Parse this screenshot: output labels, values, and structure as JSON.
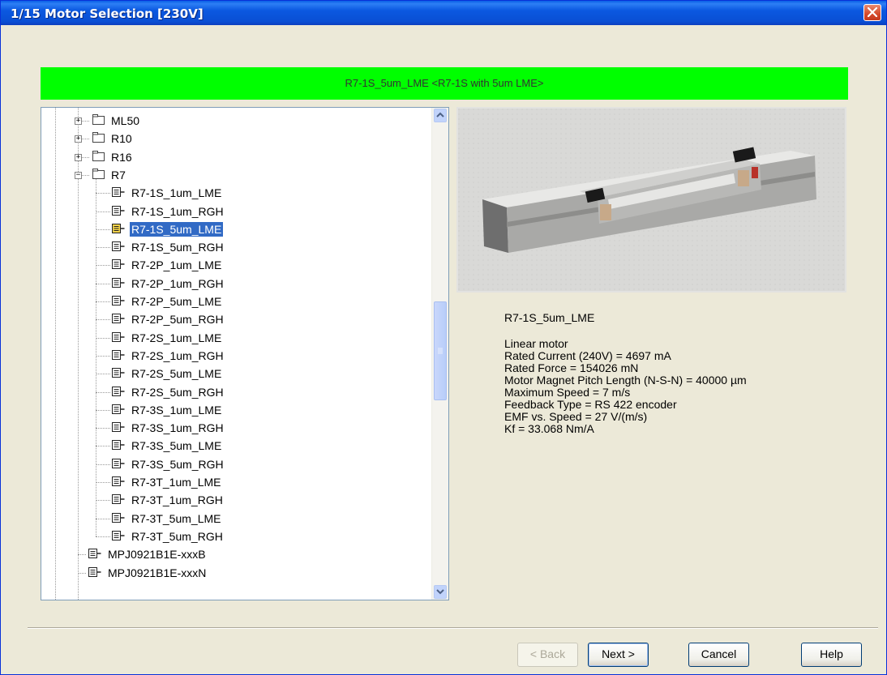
{
  "window": {
    "title": "1/15 Motor Selection [230V]"
  },
  "banner": {
    "text": "R7-1S_5um_LME  <R7-1S with 5um LME>",
    "color": "#00ff00"
  },
  "tree": {
    "folders": [
      "ML50",
      "R10",
      "R16",
      "R7"
    ],
    "r7_items": [
      "R7-1S_1um_LME",
      "R7-1S_1um_RGH",
      "R7-1S_5um_LME",
      "R7-1S_5um_RGH",
      "R7-2P_1um_LME",
      "R7-2P_1um_RGH",
      "R7-2P_5um_LME",
      "R7-2P_5um_RGH",
      "R7-2S_1um_LME",
      "R7-2S_1um_RGH",
      "R7-2S_5um_LME",
      "R7-2S_5um_RGH",
      "R7-3S_1um_LME",
      "R7-3S_1um_RGH",
      "R7-3S_5um_LME",
      "R7-3S_5um_RGH",
      "R7-3T_1um_LME",
      "R7-3T_1um_RGH",
      "R7-3T_5um_LME",
      "R7-3T_5um_RGH"
    ],
    "selected": "R7-1S_5um_LME",
    "bottom_items": [
      "MPJ0921B1E-xxxB",
      "MPJ0921B1E-xxxN"
    ]
  },
  "details": {
    "name": "R7-1S_5um_LME",
    "lines": [
      "Linear motor",
      "Rated Current (240V)  =  4697 mA",
      "Rated Force  =  154026 mN",
      "Motor Magnet Pitch Length (N-S-N)  =  40000 µm",
      "Maximum Speed  =  7 m/s",
      "Feedback Type = RS 422 encoder",
      "EMF vs. Speed  =  27 V/(m/s)",
      "Kf = 33.068 Nm/A"
    ]
  },
  "buttons": {
    "back": "< Back",
    "next": "Next >",
    "cancel": "Cancel",
    "help": "Help"
  },
  "icons": {
    "close": "close-icon",
    "folder": "folder-icon",
    "item": "motor-item-icon"
  }
}
